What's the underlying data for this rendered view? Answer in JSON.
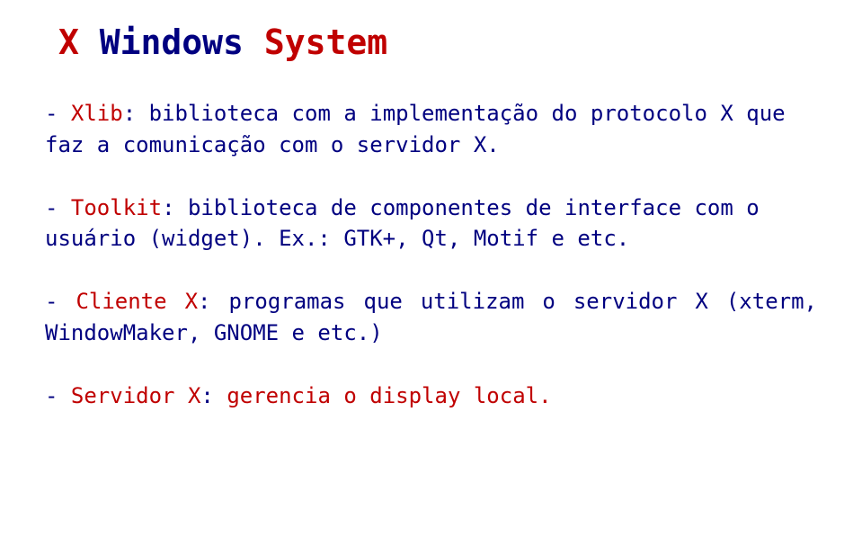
{
  "title": {
    "w1": "X",
    "w2": "Windows",
    "w3": "System"
  },
  "items": {
    "xlib_prefix": "- ",
    "xlib_label": "Xlib",
    "xlib_text": ": biblioteca com a implementação do protocolo X que faz a comunicação com o servidor X.",
    "toolkit_prefix": "- ",
    "toolkit_label": "Toolkit",
    "toolkit_text": ": biblioteca de componentes de interface com o usuário (widget). Ex.: GTK+, Qt, Motif e etc.",
    "client_prefix": "- ",
    "client_label": "Cliente X",
    "client_text": ": programas que utilizam o servidor X (xterm, WindowMaker, GNOME e etc.)",
    "server_prefix": "- ",
    "server_label": "Servidor X",
    "server_text1": ": ",
    "server_text_emph": "gerencia o display local.",
    "server_text2": ""
  }
}
